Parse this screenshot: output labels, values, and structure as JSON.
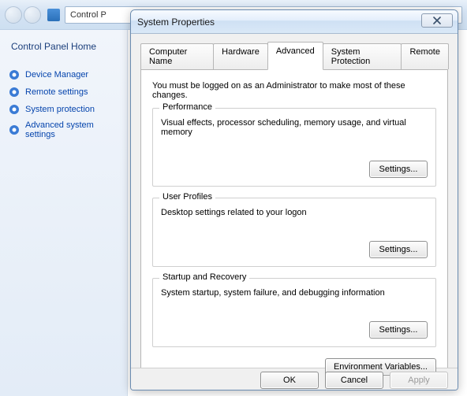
{
  "breadcrumb": {
    "part1": "Control P"
  },
  "sidebar": {
    "home_label": "Control Panel Home",
    "items": [
      {
        "label": "Device Manager"
      },
      {
        "label": "Remote settings"
      },
      {
        "label": "System protection"
      },
      {
        "label": "Advanced system settings"
      }
    ]
  },
  "dialog": {
    "title": "System Properties",
    "tabs": [
      {
        "label": "Computer Name"
      },
      {
        "label": "Hardware"
      },
      {
        "label": "Advanced"
      },
      {
        "label": "System Protection"
      },
      {
        "label": "Remote"
      }
    ],
    "intro": "You must be logged on as an Administrator to make most of these changes.",
    "groups": [
      {
        "title": "Performance",
        "desc": "Visual effects, processor scheduling, memory usage, and virtual memory",
        "button": "Settings..."
      },
      {
        "title": "User Profiles",
        "desc": "Desktop settings related to your logon",
        "button": "Settings..."
      },
      {
        "title": "Startup and Recovery",
        "desc": "System startup, system failure, and debugging information",
        "button": "Settings..."
      }
    ],
    "env_button": "Environment Variables...",
    "footer": {
      "ok": "OK",
      "cancel": "Cancel",
      "apply": "Apply"
    }
  }
}
